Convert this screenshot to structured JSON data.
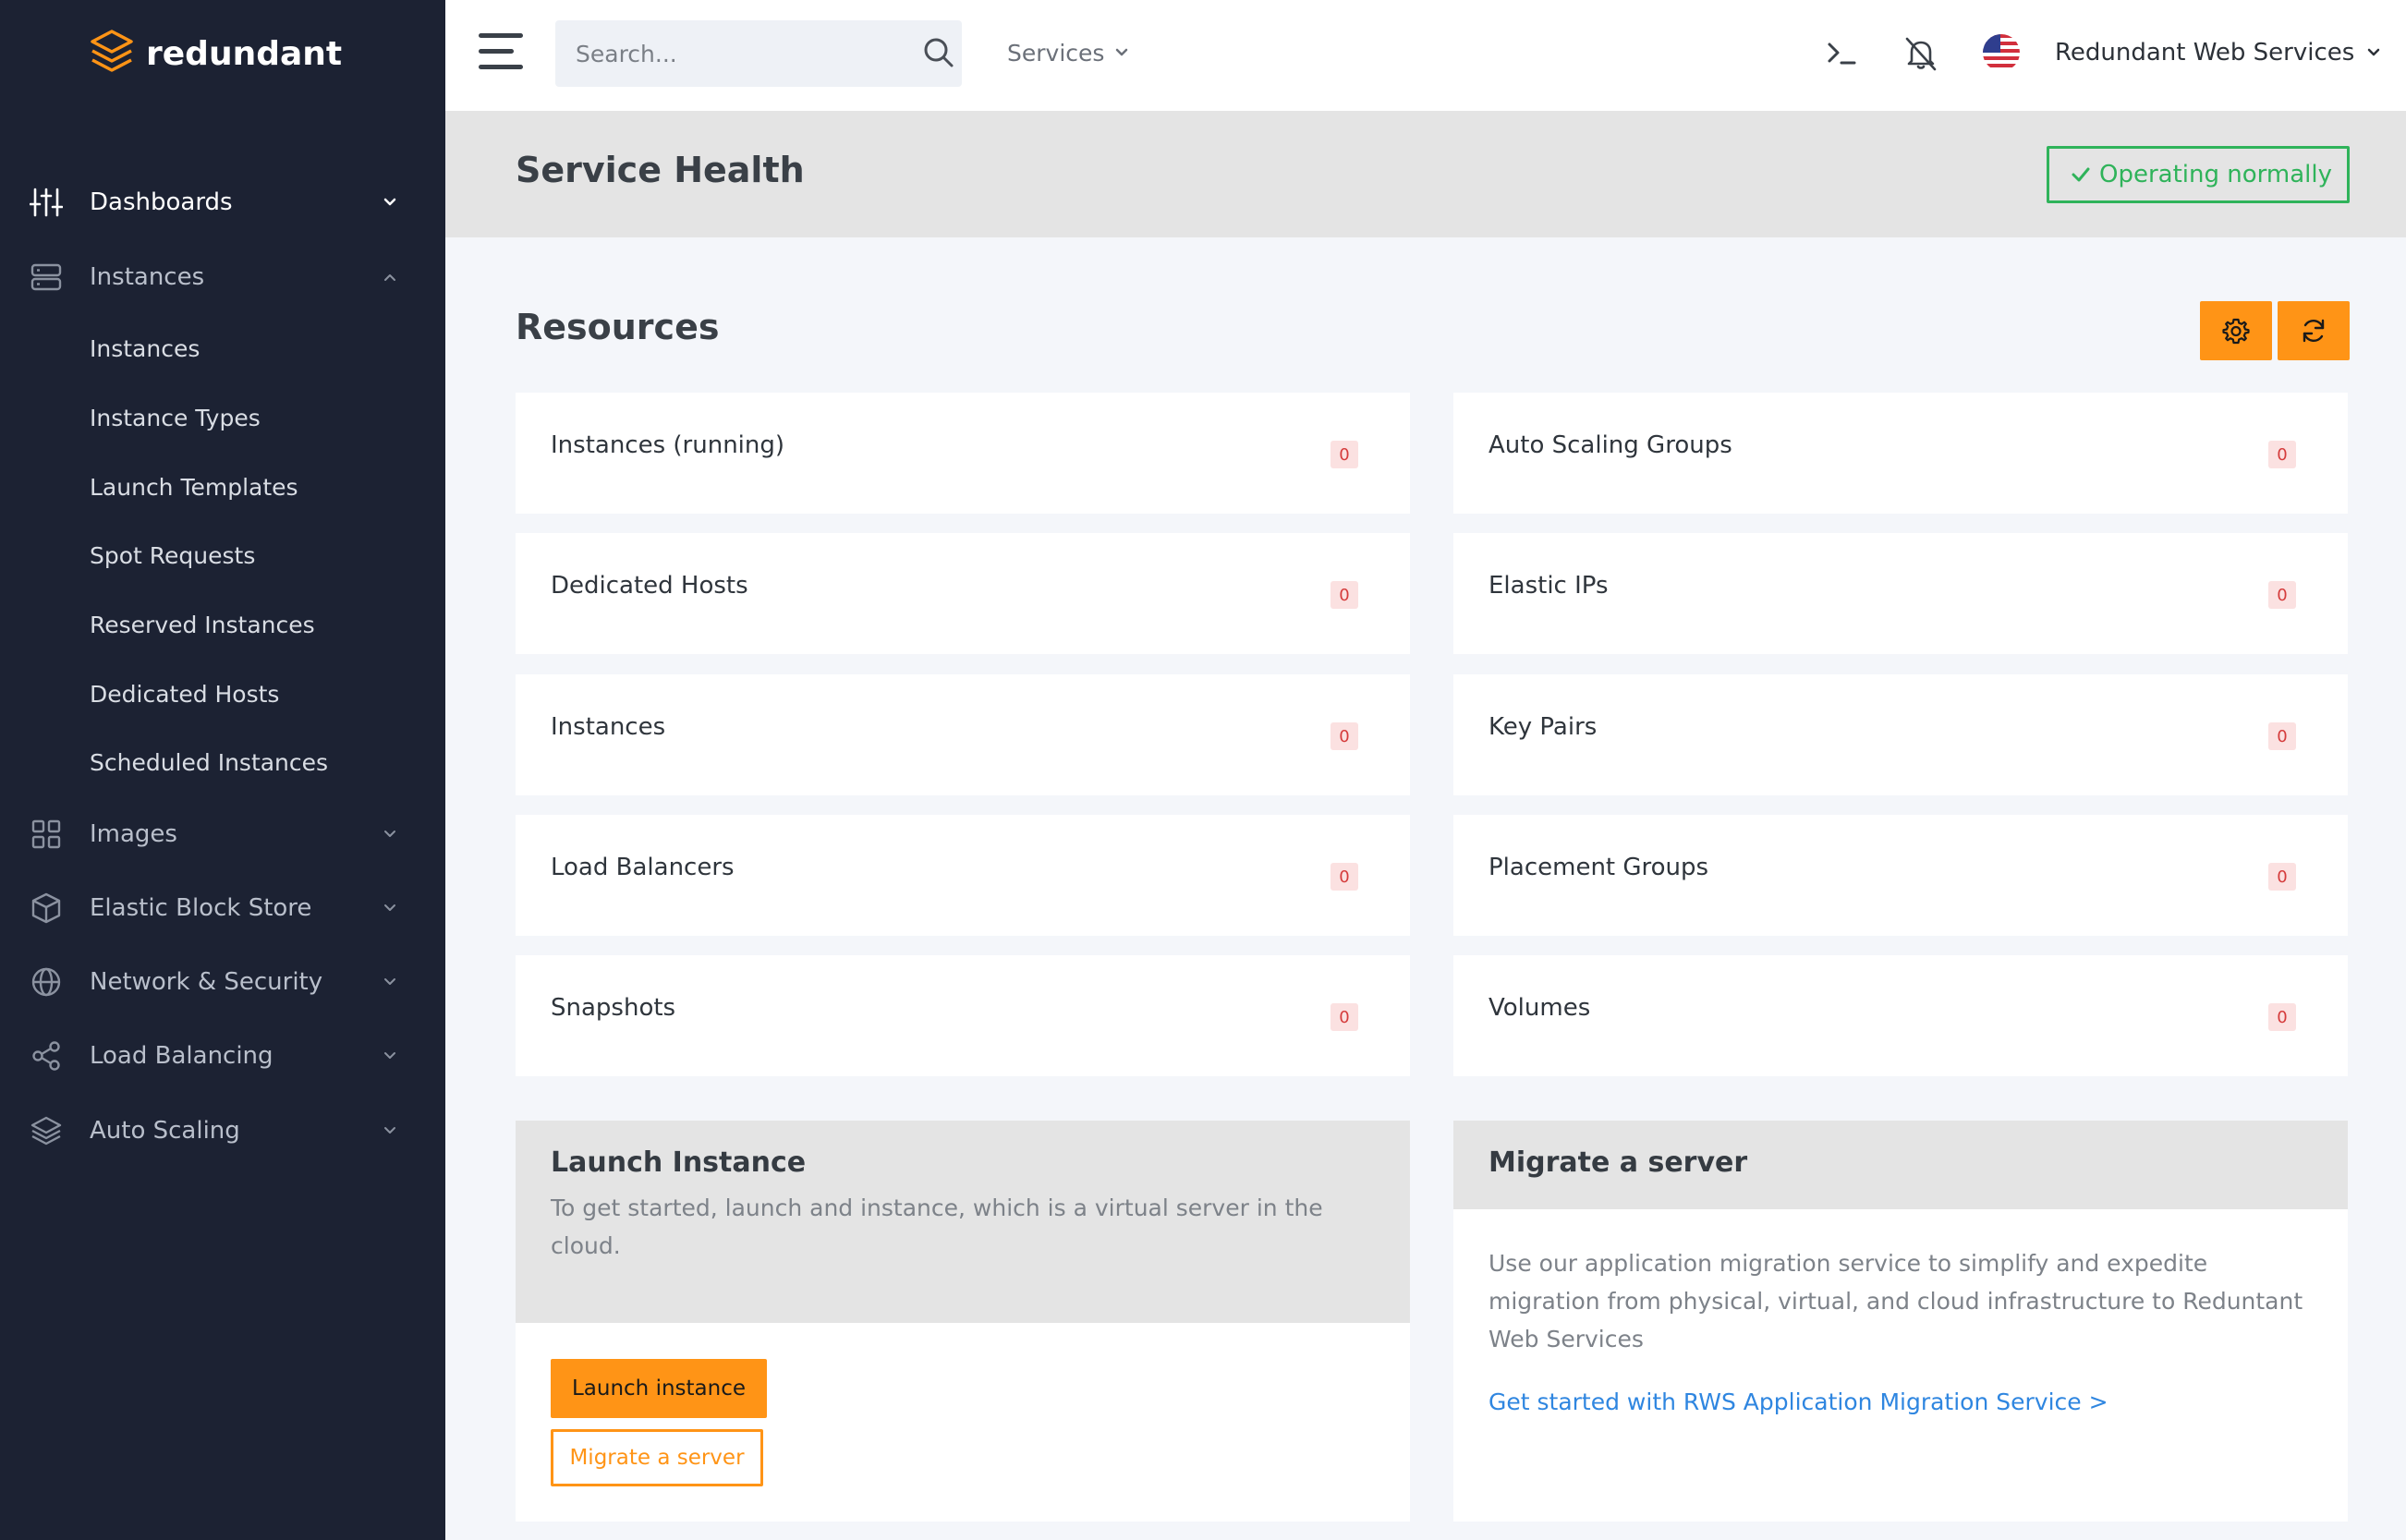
{
  "brand": {
    "name": "redundant",
    "logo_color": "#ff9416"
  },
  "sidebar": {
    "items": [
      {
        "label": "Dashboards",
        "icon": "sliders-icon",
        "expanded": true,
        "active": true
      },
      {
        "label": "Instances",
        "icon": "server-icon",
        "expanded": true
      },
      {
        "label": "Images",
        "icon": "grid-icon",
        "expanded": false
      },
      {
        "label": "Elastic Block Store",
        "icon": "cube-icon",
        "expanded": false
      },
      {
        "label": "Network & Security",
        "icon": "globe-icon",
        "expanded": false
      },
      {
        "label": "Load Balancing",
        "icon": "share-icon",
        "expanded": false
      },
      {
        "label": "Auto Scaling",
        "icon": "layers-icon",
        "expanded": false
      }
    ],
    "instances_sub": [
      "Instances",
      "Instance Types",
      "Launch Templates",
      "Spot Requests",
      "Reserved Instances",
      "Dedicated Hosts",
      "Scheduled Instances"
    ]
  },
  "topbar": {
    "search_placeholder": "Search...",
    "services_label": "Services",
    "account_label": "Redundant Web Services",
    "icons": [
      "terminal-icon",
      "bell-off-icon",
      "us-flag-icon"
    ]
  },
  "header": {
    "title": "Service Health",
    "status": "Operating normally",
    "status_color": "#2fb35a"
  },
  "resources": {
    "title": "Resources",
    "accent": "#ff9416",
    "left": [
      {
        "label": "Instances (running)",
        "count": "0"
      },
      {
        "label": "Dedicated Hosts",
        "count": "0"
      },
      {
        "label": "Instances",
        "count": "0"
      },
      {
        "label": "Load Balancers",
        "count": "0"
      },
      {
        "label": "Snapshots",
        "count": "0"
      }
    ],
    "right": [
      {
        "label": "Auto Scaling Groups",
        "count": "0"
      },
      {
        "label": "Elastic IPs",
        "count": "0"
      },
      {
        "label": "Key Pairs",
        "count": "0"
      },
      {
        "label": "Placement Groups",
        "count": "0"
      },
      {
        "label": "Volumes",
        "count": "0"
      }
    ]
  },
  "launch_panel": {
    "title": "Launch Instance",
    "description": "To get started, launch and instance, which is a virtual server in the cloud.",
    "primary_button": "Launch instance",
    "secondary_button": "Migrate a server"
  },
  "migrate_panel": {
    "title": "Migrate a server",
    "description": "Use our application migration service to simplify and expedite migration from physical, virtual, and cloud infrastructure to Reduntant Web Services",
    "link": "Get started with RWS Application Migration Service >",
    "link_color": "#2f86e0"
  }
}
